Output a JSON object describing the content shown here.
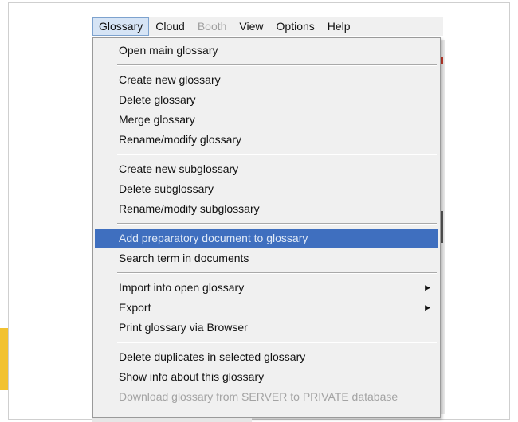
{
  "colors": {
    "accent": "#f2c230",
    "selection": "#3f6fbf",
    "menu_bg": "#f0f0f0",
    "disabled_text": "#a3a3a3"
  },
  "menubar": {
    "items": [
      {
        "label": "Glossary",
        "state": "active"
      },
      {
        "label": "Cloud",
        "state": "normal"
      },
      {
        "label": "Booth",
        "state": "disabled"
      },
      {
        "label": "View",
        "state": "normal"
      },
      {
        "label": "Options",
        "state": "normal"
      },
      {
        "label": "Help",
        "state": "normal"
      }
    ]
  },
  "glossary_menu": {
    "items": [
      {
        "label": "Open main glossary"
      },
      {
        "label": "Create new glossary"
      },
      {
        "label": "Delete glossary"
      },
      {
        "label": "Merge glossary"
      },
      {
        "label": "Rename/modify glossary"
      },
      {
        "label": "Create new subglossary"
      },
      {
        "label": "Delete subglossary"
      },
      {
        "label": "Rename/modify subglossary"
      },
      {
        "label": "Add preparatory document to glossary",
        "selected": true
      },
      {
        "label": "Search term in documents"
      },
      {
        "label": "Import into open glossary",
        "submenu": true,
        "submenu_icon": "submenu-arrow-icon"
      },
      {
        "label": "Export",
        "submenu": true,
        "submenu_icon": "submenu-arrow-icon"
      },
      {
        "label": "Print glossary via Browser"
      },
      {
        "label": "Delete duplicates in selected glossary"
      },
      {
        "label": "Show info about this glossary"
      },
      {
        "label": "Download glossary from SERVER to PRIVATE database",
        "disabled": true
      }
    ]
  }
}
